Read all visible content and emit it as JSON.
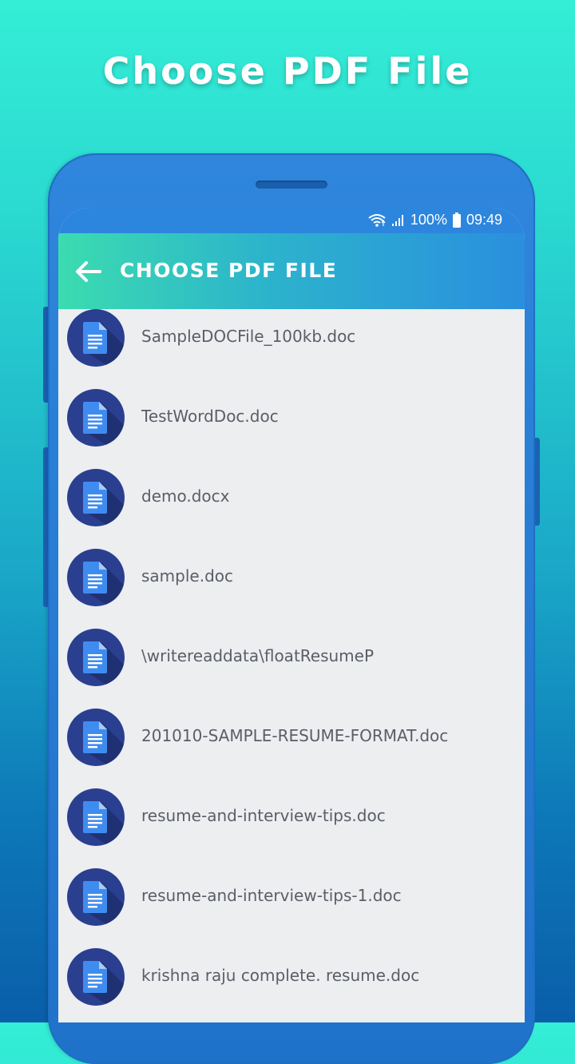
{
  "headline": "Choose PDF File",
  "status_bar": {
    "battery": "100%",
    "time": "09:49",
    "icons": [
      "wifi-icon",
      "signal-icon",
      "battery-icon"
    ]
  },
  "app_bar": {
    "title": "CHOOSE PDF FILE",
    "back_icon": "arrow-left-icon"
  },
  "files": [
    {
      "name": "SampleDOCFile_100kb.doc",
      "icon": "document-icon"
    },
    {
      "name": "TestWordDoc.doc",
      "icon": "document-icon"
    },
    {
      "name": "demo.docx",
      "icon": "document-icon"
    },
    {
      "name": "sample.doc",
      "icon": "document-icon"
    },
    {
      "name": "\\writereaddata\\floatResumeP",
      "icon": "document-icon"
    },
    {
      "name": "201010-SAMPLE-RESUME-FORMAT.doc",
      "icon": "document-icon"
    },
    {
      "name": "resume-and-interview-tips.doc",
      "icon": "document-icon"
    },
    {
      "name": "resume-and-interview-tips-1.doc",
      "icon": "document-icon"
    },
    {
      "name": "krishna raju complete. resume.doc",
      "icon": "document-icon"
    }
  ],
  "colors": {
    "background_top": "#34eed6",
    "background_bottom": "#0a5ea9",
    "phone_body": "#2f86dc",
    "appbar_start": "#3bdcb0",
    "appbar_end": "#2a8fde",
    "avatar_bg": "#2a3f8f",
    "doc_icon": "#3f8cf0",
    "list_bg": "#eceef0",
    "file_text": "#5a5e66"
  }
}
